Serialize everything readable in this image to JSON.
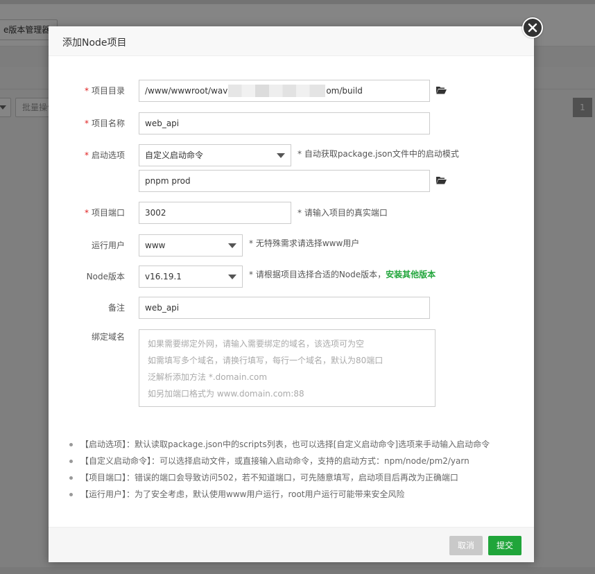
{
  "background": {
    "nvm_button_label": "e版本管理器",
    "batch_label": "批量操作",
    "pager_label": "1"
  },
  "dialog": {
    "title": "添加Node项目",
    "fields": {
      "project_dir": {
        "label": "项目目录",
        "value_prefix": "/www/wwwroot/wav",
        "value_suffix": "om/build"
      },
      "project_name": {
        "label": "项目名称",
        "value": "web_api"
      },
      "start_option": {
        "label": "启动选项",
        "selected": "自定义启动命令",
        "hint": "* 自动获取package.json文件中的启动模式",
        "command_value": "pnpm prod"
      },
      "project_port": {
        "label": "项目端口",
        "value": "3002",
        "hint": "* 请输入项目的真实端口"
      },
      "run_user": {
        "label": "运行用户",
        "selected": "www",
        "hint": "* 无特殊需求请选择www用户"
      },
      "node_version": {
        "label": "Node版本",
        "selected": "v16.19.1",
        "hint": "* 请根据项目选择合适的Node版本，",
        "hint_link": "安装其他版本"
      },
      "remark": {
        "label": "备注",
        "value": "web_api"
      },
      "bind_domain": {
        "label": "绑定域名",
        "placeholder_lines": [
          "如果需要绑定外网，请输入需要绑定的域名，该选项可为空",
          "如需填写多个域名，请换行填写，每行一个域名，默认为80端口",
          "泛解析添加方法 *.domain.com",
          "如另加端口格式为 www.domain.com:88"
        ]
      }
    },
    "tips": [
      "【启动选项】：默认读取package.json中的scripts列表，也可以选择[自定义启动命令]选项来手动输入启动命令",
      "【自定义启动命令】：可以选择启动文件，或直接输入启动命令，支持的启动方式：npm/node/pm2/yarn",
      "【项目端口】：错误的端口会导致访问502，若不知道端口，可先随意填写，启动项目后再改为正确端口",
      "【运行用户】：为了安全考虑，默认使用www用户运行，root用户运行可能带来安全风险"
    ],
    "buttons": {
      "cancel": "取消",
      "submit": "提交"
    }
  },
  "icons": {
    "close": "close-icon",
    "folder": "folder-open-icon",
    "dropdown": "chevron-down-icon"
  },
  "colors": {
    "accent_green": "#20a53a",
    "required_red": "#e02020",
    "cancel_gray": "#c9c9c9"
  }
}
